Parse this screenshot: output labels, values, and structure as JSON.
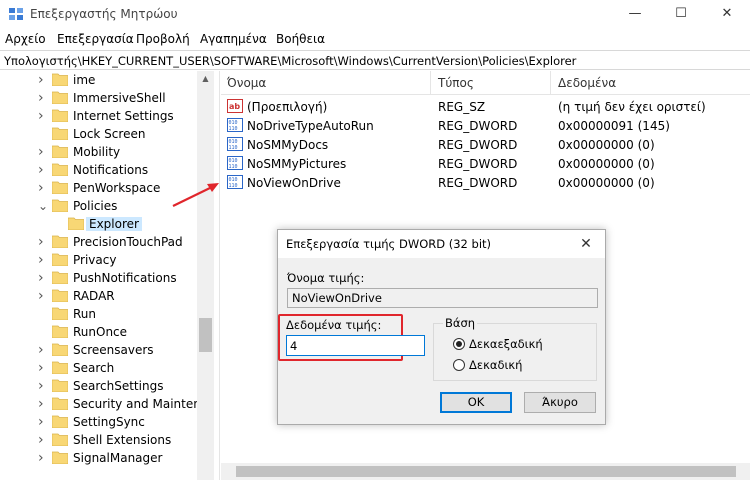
{
  "window": {
    "title": "Επεξεργαστής Μητρώου",
    "minimize": "—",
    "maximize": "☐",
    "close": "✕"
  },
  "menu": [
    "Αρχείο",
    "Επεξεργασία",
    "Προβολή",
    "Αγαπημένα",
    "Βοήθεια"
  ],
  "address": "Υπολογιστής\\HKEY_CURRENT_USER\\SOFTWARE\\Microsoft\\Windows\\CurrentVersion\\Policies\\Explorer",
  "tree": [
    {
      "label": "ime",
      "state": "collapsed"
    },
    {
      "label": "ImmersiveShell",
      "state": "collapsed"
    },
    {
      "label": "Internet Settings",
      "state": "collapsed"
    },
    {
      "label": "Lock Screen",
      "state": "none"
    },
    {
      "label": "Mobility",
      "state": "collapsed"
    },
    {
      "label": "Notifications",
      "state": "collapsed"
    },
    {
      "label": "PenWorkspace",
      "state": "collapsed"
    },
    {
      "label": "Policies",
      "state": "expanded"
    },
    {
      "label": "Explorer",
      "state": "selected"
    },
    {
      "label": "PrecisionTouchPad",
      "state": "collapsed"
    },
    {
      "label": "Privacy",
      "state": "collapsed"
    },
    {
      "label": "PushNotifications",
      "state": "collapsed"
    },
    {
      "label": "RADAR",
      "state": "collapsed"
    },
    {
      "label": "Run",
      "state": "none"
    },
    {
      "label": "RunOnce",
      "state": "none"
    },
    {
      "label": "Screensavers",
      "state": "collapsed"
    },
    {
      "label": "Search",
      "state": "collapsed"
    },
    {
      "label": "SearchSettings",
      "state": "collapsed"
    },
    {
      "label": "Security and Maintenar",
      "state": "collapsed"
    },
    {
      "label": "SettingSync",
      "state": "collapsed"
    },
    {
      "label": "Shell Extensions",
      "state": "collapsed"
    },
    {
      "label": "SignalManager",
      "state": "collapsed"
    }
  ],
  "list": {
    "columns": [
      "Όνομα",
      "Τύπος",
      "Δεδομένα"
    ],
    "rows": [
      {
        "icon": "string-value-icon",
        "name": "(Προεπιλογή)",
        "type": "REG_SZ",
        "data": "(η τιμή δεν έχει οριστεί)"
      },
      {
        "icon": "binary-value-icon",
        "name": "NoDriveTypeAutoRun",
        "type": "REG_DWORD",
        "data": "0x00000091 (145)"
      },
      {
        "icon": "binary-value-icon",
        "name": "NoSMMyDocs",
        "type": "REG_DWORD",
        "data": "0x00000000 (0)"
      },
      {
        "icon": "binary-value-icon",
        "name": "NoSMMyPictures",
        "type": "REG_DWORD",
        "data": "0x00000000 (0)"
      },
      {
        "icon": "binary-value-icon",
        "name": "NoViewOnDrive",
        "type": "REG_DWORD",
        "data": "0x00000000 (0)"
      }
    ]
  },
  "dialog": {
    "title": "Επεξεργασία τιμής DWORD (32 bit)",
    "close": "✕",
    "name_label": "Όνομα τιμής:",
    "name_value": "NoViewOnDrive",
    "value_label": "Δεδομένα τιμής:",
    "value": "4",
    "base_label": "Βάση",
    "hex_label": "Δεκαεξαδική",
    "dec_label": "Δεκαδική",
    "ok": "OK",
    "cancel": "Άκυρο"
  },
  "colors": {
    "highlight": "#e0262c",
    "selection": "#cce8ff",
    "folder": "#f8d775",
    "accent": "#0078d7"
  }
}
